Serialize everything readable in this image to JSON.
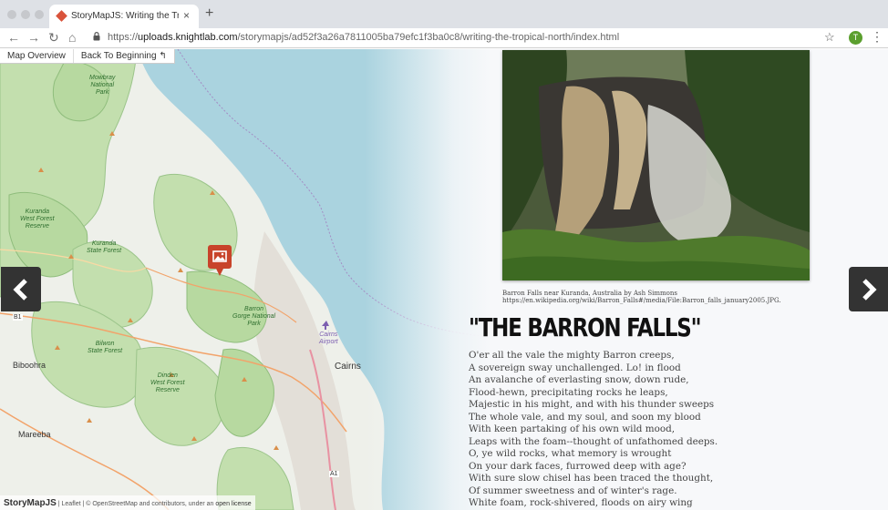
{
  "browser": {
    "tab_title": "StoryMapJS: Writing the Tropical North",
    "tab_close": "×",
    "new_tab": "+",
    "url_scheme": "https://",
    "url_host": "uploads.knightlab.com",
    "url_path": "/storymapjs/ad52f3a26a7811005ba79efc1f3ba0c8/writing-the-tropical-north/index.html",
    "avatar_letter": "T",
    "nav": {
      "back": "←",
      "forward": "→",
      "reload": "↻",
      "home": "⌂"
    },
    "star": "☆",
    "menu": "⋮"
  },
  "map_nav": {
    "overview_label": "Map Overview",
    "back_label": "Back To Beginning ↰"
  },
  "map_labels": {
    "mowbray": "Mowbray\nNational\nPark",
    "kuranda_west": "Kuranda\nWest Forest\nReserve",
    "kuranda_state": "Kuranda\nState Forest",
    "barron_gorge": "Barron\nGorge National\nPark",
    "bilwon": "Bilwon\nState Forest",
    "dinden": "Dinden\nWest Forest\nReserve",
    "biboohra": "Biboohra",
    "mareeba": "Mareeba",
    "cairns": "Cairns",
    "cairns_airport": "Cairns\nAirport",
    "route_b1": "B1",
    "route_a1": "A1"
  },
  "controls": {
    "prev_arrow": "‹",
    "next_arrow": "›"
  },
  "slide": {
    "caption_line1": "Barron Falls near Kuranda, Australia by Ash Simmons",
    "caption_line2": "https://en.wikipedia.org/wiki/Barron_Falls#/media/File:Barron_falls_january2005.JPG.",
    "headline": "\"THE BARRON FALLS\"",
    "poem": [
      "O'er all the vale the mighty Barron creeps,",
      "A sovereign sway unchallenged. Lo! in flood",
      "An avalanche of everlasting snow, down rude,",
      "Flood-hewn, precipitating rocks he leaps,",
      "Majestic in his might, and with his thunder sweeps",
      "The whole vale, and my soul, and soon my blood",
      "With keen partaking of his own wild mood,",
      "Leaps with the foam--thought of unfathomed deeps.",
      "O, ye wild rocks, what memory is wrought",
      "On your dark faces, furrowed deep with age?",
      "With sure slow chisel has been traced the thought,",
      "Of summer sweetness and of winter's rage.",
      "White foam, rock-shivered, floods on airy wing"
    ]
  },
  "attribution": {
    "brand": "StoryMapJS",
    "text": "| Leaflet | © OpenStreetMap and contributors, under an",
    "license": "open license"
  },
  "colors": {
    "forest": "#c3dfae",
    "water": "#aad3df",
    "arrow_bg": "#333333",
    "marker": "#c8432a"
  }
}
